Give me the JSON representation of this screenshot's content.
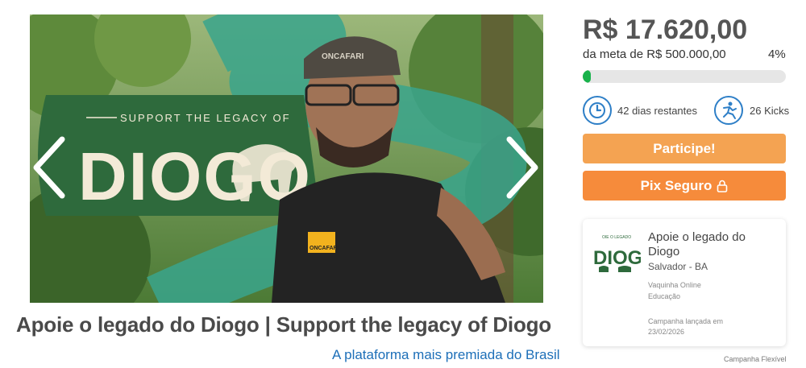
{
  "hero": {
    "banner_tagline": "SUPPORT THE LEGACY OF",
    "banner_name": "DIOGO",
    "cap_text": "ONCAFARI",
    "shirt_text": "ONCAFARI"
  },
  "campaign": {
    "title": "Apoie o legado do Diogo | Support the legacy of Diogo",
    "tagline": "A plataforma mais premiada do Brasil"
  },
  "funding": {
    "amount": "R$ 17.620,00",
    "goal_text": "da meta de R$ 500.000,00",
    "percent_text": "4%",
    "progress_fraction": 0.04,
    "days_left": "42 dias restantes",
    "kicks": "26 Kicks"
  },
  "buttons": {
    "participe": "Participe!",
    "pix": "Pix Seguro"
  },
  "card": {
    "name": "Apoie o legado do Diogo",
    "location": "Salvador - BA",
    "type": "Vaquinha Online",
    "category": "Educação",
    "launch": "Campanha lançada em 23/02/2026",
    "logo_text": "DIOGO"
  },
  "footer": {
    "flex": "Campanha Flexível"
  },
  "colors": {
    "accent_blue": "#2e7fc7",
    "progress_green": "#19b24b",
    "btn_orange_light": "#f4a352",
    "btn_orange": "#f68b3b",
    "banner_green": "#2e6a3c"
  }
}
